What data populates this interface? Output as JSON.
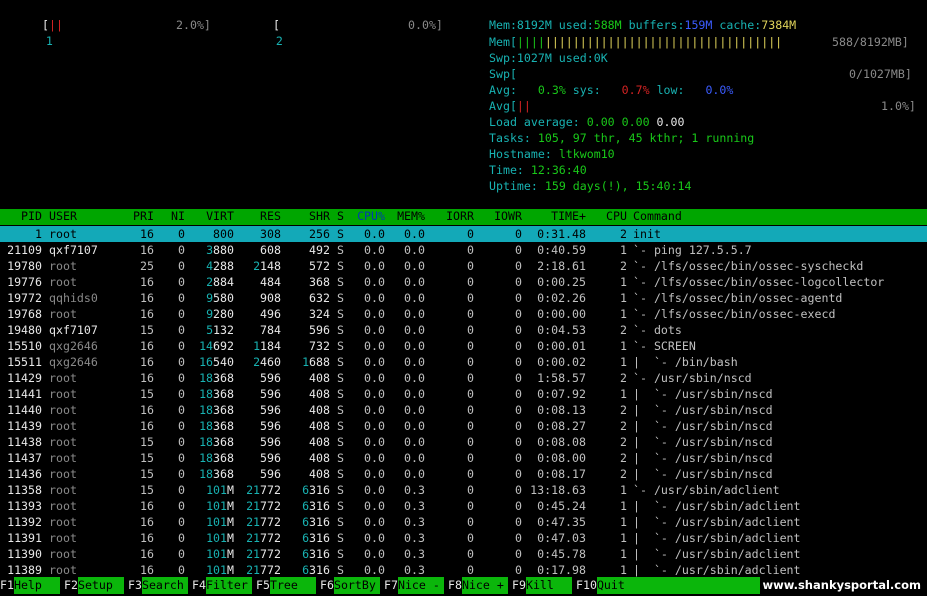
{
  "cpu_meters": [
    {
      "id": "1",
      "bar": "||",
      "percent": "2.0%]",
      "fraction": 0.02
    },
    {
      "id": "2",
      "bar": "",
      "percent": "0.0%]",
      "fraction": 0.0
    }
  ],
  "summary": {
    "mem_line": {
      "label": "Mem:",
      "total": "8192M",
      "used_label": " used:",
      "used": "588M",
      "buffers_label": " buffers:",
      "buffers": "159M",
      "cache_label": " cache:",
      "cache": "7384M"
    },
    "mem_bar": {
      "label": "Mem[",
      "used_bar": "||||",
      "cache_bar": "||||||||||||||||||||||||||||||||||",
      "value": "588/8192MB]"
    },
    "swp_line": {
      "label": "Swp:",
      "total": "1027M",
      "used_label": " used:",
      "used": "0K"
    },
    "swp_bar": {
      "label": "Swp[",
      "value": "0/1027MB]"
    },
    "avg_line": {
      "label": "Avg:",
      "user": "0.3%",
      "sys_label": "sys:",
      "sys": "0.7%",
      "low_label": "low:",
      "low": "0.0%"
    },
    "avg_bar": {
      "label": "Avg[",
      "bar": "||",
      "value": "1.0%]"
    },
    "load": {
      "label": "Load average:",
      "v1": "0.00",
      "v5": "0.00",
      "v15": "0.00"
    },
    "tasks": {
      "label": "Tasks:",
      "value": "105, 97 thr, 45 kthr; 1 running"
    },
    "hostname": {
      "label": "Hostname:",
      "value": "ltkwom10"
    },
    "time": {
      "label": "Time:",
      "value": "12:36:40"
    },
    "uptime": {
      "label": "Uptime:",
      "value": "159 days(!), 15:40:14"
    }
  },
  "columns": [
    "PID",
    "USER",
    "PRI",
    "NI",
    "VIRT",
    "RES",
    "SHR",
    "S",
    "CPU%",
    "MEM%",
    "IORR",
    "IOWR",
    "TIME+",
    "CPU",
    "Command"
  ],
  "processes": [
    {
      "pid": "1",
      "user": "root",
      "pri": "16",
      "ni": "0",
      "virt": "800",
      "res": "308",
      "shr": "256",
      "s": "S",
      "cpu": "0.0",
      "mem": "0.0",
      "iorr": "0",
      "iowr": "0",
      "time": "0:31.48",
      "cpun": "2",
      "cmd": "init",
      "selected": true
    },
    {
      "pid": "21109",
      "user": "qxf7107",
      "pri": "16",
      "ni": "0",
      "virt": "3880",
      "res": "608",
      "shr": "492",
      "s": "S",
      "cpu": "0.0",
      "mem": "0.0",
      "iorr": "0",
      "iowr": "0",
      "time": "0:40.59",
      "cpun": "1",
      "cmd": "`- ping 127.5.5.7"
    },
    {
      "pid": "19780",
      "user": "root",
      "pri": "25",
      "ni": "0",
      "virt": "4288",
      "res": "2148",
      "shr": "572",
      "s": "S",
      "cpu": "0.0",
      "mem": "0.0",
      "iorr": "0",
      "iowr": "0",
      "time": "2:18.61",
      "cpun": "2",
      "cmd": "`- /lfs/ossec/bin/ossec-syscheckd"
    },
    {
      "pid": "19776",
      "user": "root",
      "pri": "16",
      "ni": "0",
      "virt": "2884",
      "res": "484",
      "shr": "368",
      "s": "S",
      "cpu": "0.0",
      "mem": "0.0",
      "iorr": "0",
      "iowr": "0",
      "time": "0:00.25",
      "cpun": "1",
      "cmd": "`- /lfs/ossec/bin/ossec-logcollector"
    },
    {
      "pid": "19772",
      "user": "qqhids0",
      "pri": "16",
      "ni": "0",
      "virt": "9580",
      "res": "908",
      "shr": "632",
      "s": "S",
      "cpu": "0.0",
      "mem": "0.0",
      "iorr": "0",
      "iowr": "0",
      "time": "0:02.26",
      "cpun": "1",
      "cmd": "`- /lfs/ossec/bin/ossec-agentd"
    },
    {
      "pid": "19768",
      "user": "root",
      "pri": "16",
      "ni": "0",
      "virt": "9280",
      "res": "496",
      "shr": "324",
      "s": "S",
      "cpu": "0.0",
      "mem": "0.0",
      "iorr": "0",
      "iowr": "0",
      "time": "0:00.00",
      "cpun": "1",
      "cmd": "`- /lfs/ossec/bin/ossec-execd"
    },
    {
      "pid": "19480",
      "user": "qxf7107",
      "pri": "15",
      "ni": "0",
      "virt": "5132",
      "res": "784",
      "shr": "596",
      "s": "S",
      "cpu": "0.0",
      "mem": "0.0",
      "iorr": "0",
      "iowr": "0",
      "time": "0:04.53",
      "cpun": "2",
      "cmd": "`- dots"
    },
    {
      "pid": "15510",
      "user": "qxg2646",
      "pri": "16",
      "ni": "0",
      "virt": "14692",
      "res": "1184",
      "shr": "732",
      "s": "S",
      "cpu": "0.0",
      "mem": "0.0",
      "iorr": "0",
      "iowr": "0",
      "time": "0:00.01",
      "cpun": "1",
      "cmd": "`- SCREEN"
    },
    {
      "pid": "15511",
      "user": "qxg2646",
      "pri": "16",
      "ni": "0",
      "virt": "16540",
      "res": "2460",
      "shr": "1688",
      "s": "S",
      "cpu": "0.0",
      "mem": "0.0",
      "iorr": "0",
      "iowr": "0",
      "time": "0:00.02",
      "cpun": "1",
      "cmd": "|  `- /bin/bash"
    },
    {
      "pid": "11429",
      "user": "root",
      "pri": "16",
      "ni": "0",
      "virt": "18368",
      "res": "596",
      "shr": "408",
      "s": "S",
      "cpu": "0.0",
      "mem": "0.0",
      "iorr": "0",
      "iowr": "0",
      "time": "1:58.57",
      "cpun": "2",
      "cmd": "`- /usr/sbin/nscd"
    },
    {
      "pid": "11441",
      "user": "root",
      "pri": "15",
      "ni": "0",
      "virt": "18368",
      "res": "596",
      "shr": "408",
      "s": "S",
      "cpu": "0.0",
      "mem": "0.0",
      "iorr": "0",
      "iowr": "0",
      "time": "0:07.92",
      "cpun": "1",
      "cmd": "|  `- /usr/sbin/nscd"
    },
    {
      "pid": "11440",
      "user": "root",
      "pri": "16",
      "ni": "0",
      "virt": "18368",
      "res": "596",
      "shr": "408",
      "s": "S",
      "cpu": "0.0",
      "mem": "0.0",
      "iorr": "0",
      "iowr": "0",
      "time": "0:08.13",
      "cpun": "2",
      "cmd": "|  `- /usr/sbin/nscd"
    },
    {
      "pid": "11439",
      "user": "root",
      "pri": "16",
      "ni": "0",
      "virt": "18368",
      "res": "596",
      "shr": "408",
      "s": "S",
      "cpu": "0.0",
      "mem": "0.0",
      "iorr": "0",
      "iowr": "0",
      "time": "0:08.27",
      "cpun": "2",
      "cmd": "|  `- /usr/sbin/nscd"
    },
    {
      "pid": "11438",
      "user": "root",
      "pri": "15",
      "ni": "0",
      "virt": "18368",
      "res": "596",
      "shr": "408",
      "s": "S",
      "cpu": "0.0",
      "mem": "0.0",
      "iorr": "0",
      "iowr": "0",
      "time": "0:08.08",
      "cpun": "2",
      "cmd": "|  `- /usr/sbin/nscd"
    },
    {
      "pid": "11437",
      "user": "root",
      "pri": "15",
      "ni": "0",
      "virt": "18368",
      "res": "596",
      "shr": "408",
      "s": "S",
      "cpu": "0.0",
      "mem": "0.0",
      "iorr": "0",
      "iowr": "0",
      "time": "0:08.00",
      "cpun": "2",
      "cmd": "|  `- /usr/sbin/nscd"
    },
    {
      "pid": "11436",
      "user": "root",
      "pri": "15",
      "ni": "0",
      "virt": "18368",
      "res": "596",
      "shr": "408",
      "s": "S",
      "cpu": "0.0",
      "mem": "0.0",
      "iorr": "0",
      "iowr": "0",
      "time": "0:08.17",
      "cpun": "2",
      "cmd": "|  `- /usr/sbin/nscd"
    },
    {
      "pid": "11358",
      "user": "root",
      "pri": "15",
      "ni": "0",
      "virt": "101M",
      "res": "21772",
      "shr": "6316",
      "s": "S",
      "cpu": "0.0",
      "mem": "0.3",
      "iorr": "0",
      "iowr": "0",
      "time": "13:18.63",
      "cpun": "1",
      "cmd": "`- /usr/sbin/adclient"
    },
    {
      "pid": "11393",
      "user": "root",
      "pri": "16",
      "ni": "0",
      "virt": "101M",
      "res": "21772",
      "shr": "6316",
      "s": "S",
      "cpu": "0.0",
      "mem": "0.3",
      "iorr": "0",
      "iowr": "0",
      "time": "0:45.24",
      "cpun": "1",
      "cmd": "|  `- /usr/sbin/adclient"
    },
    {
      "pid": "11392",
      "user": "root",
      "pri": "16",
      "ni": "0",
      "virt": "101M",
      "res": "21772",
      "shr": "6316",
      "s": "S",
      "cpu": "0.0",
      "mem": "0.3",
      "iorr": "0",
      "iowr": "0",
      "time": "0:47.35",
      "cpun": "1",
      "cmd": "|  `- /usr/sbin/adclient"
    },
    {
      "pid": "11391",
      "user": "root",
      "pri": "16",
      "ni": "0",
      "virt": "101M",
      "res": "21772",
      "shr": "6316",
      "s": "S",
      "cpu": "0.0",
      "mem": "0.3",
      "iorr": "0",
      "iowr": "0",
      "time": "0:47.03",
      "cpun": "1",
      "cmd": "|  `- /usr/sbin/adclient"
    },
    {
      "pid": "11390",
      "user": "root",
      "pri": "16",
      "ni": "0",
      "virt": "101M",
      "res": "21772",
      "shr": "6316",
      "s": "S",
      "cpu": "0.0",
      "mem": "0.3",
      "iorr": "0",
      "iowr": "0",
      "time": "0:45.78",
      "cpun": "1",
      "cmd": "|  `- /usr/sbin/adclient"
    },
    {
      "pid": "11389",
      "user": "root",
      "pri": "16",
      "ni": "0",
      "virt": "101M",
      "res": "21772",
      "shr": "6316",
      "s": "S",
      "cpu": "0.0",
      "mem": "0.3",
      "iorr": "0",
      "iowr": "0",
      "time": "0:17.98",
      "cpun": "1",
      "cmd": "|  `- /usr/sbin/adclient"
    }
  ],
  "function_keys": [
    {
      "key": "F1",
      "label": "Help"
    },
    {
      "key": "F2",
      "label": "Setup"
    },
    {
      "key": "F3",
      "label": "Search"
    },
    {
      "key": "F4",
      "label": "Filter"
    },
    {
      "key": "F5",
      "label": "Tree"
    },
    {
      "key": "F6",
      "label": "SortBy"
    },
    {
      "key": "F7",
      "label": "Nice -"
    },
    {
      "key": "F8",
      "label": "Nice +"
    },
    {
      "key": "F9",
      "label": "Kill"
    },
    {
      "key": "F10",
      "label": "Quit"
    }
  ],
  "watermark": "www.shankysportal.com",
  "colors": {
    "header_bg": "#00a600",
    "selected_bg": "#13a9b8",
    "fkey_bg": "#0bb60b",
    "cyan": "#18b2b2",
    "green": "#19c819",
    "red": "#d42323",
    "blue": "#3b5cff"
  }
}
